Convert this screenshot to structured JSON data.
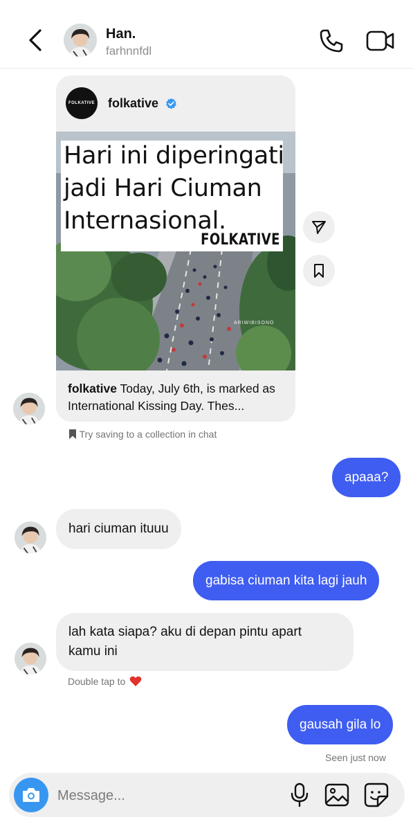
{
  "header": {
    "name": "Han.",
    "username": "farhnnfdl"
  },
  "shared_post": {
    "account": "folkative",
    "logo_text": "FOLKATIVE",
    "image_headline_lines": [
      "Hari ini diperingati",
      "jadi Hari Ciuman",
      "Internasional."
    ],
    "image_brand": "FOLKATIVE",
    "photo_credit": "ARIWIBISONO",
    "caption_account": "folkative",
    "caption_text": " Today, July 6th, is marked as International Kissing Day. Thes..."
  },
  "save_hint": "Try saving to a collection in chat",
  "messages": [
    {
      "side": "sent",
      "text": "apaaa?"
    },
    {
      "side": "received",
      "text": "hari ciuman ituuu"
    },
    {
      "side": "sent",
      "text": "gabisa ciuman kita lagi jauh"
    },
    {
      "side": "received",
      "text_line1": "lah kata siapa? aku di depan pintu apart",
      "text_line2": "kamu ini"
    },
    {
      "side": "sent",
      "text": "gausah gila lo"
    }
  ],
  "double_tap_hint": "Double tap to",
  "seen_status": "Seen just now",
  "composer": {
    "placeholder": "Message..."
  },
  "colors": {
    "sent_bubble": "#3f5df0",
    "received_bubble": "#efefef",
    "camera_button": "#3797f0",
    "verified_badge": "#3897f0",
    "heart": "#e0332b"
  }
}
